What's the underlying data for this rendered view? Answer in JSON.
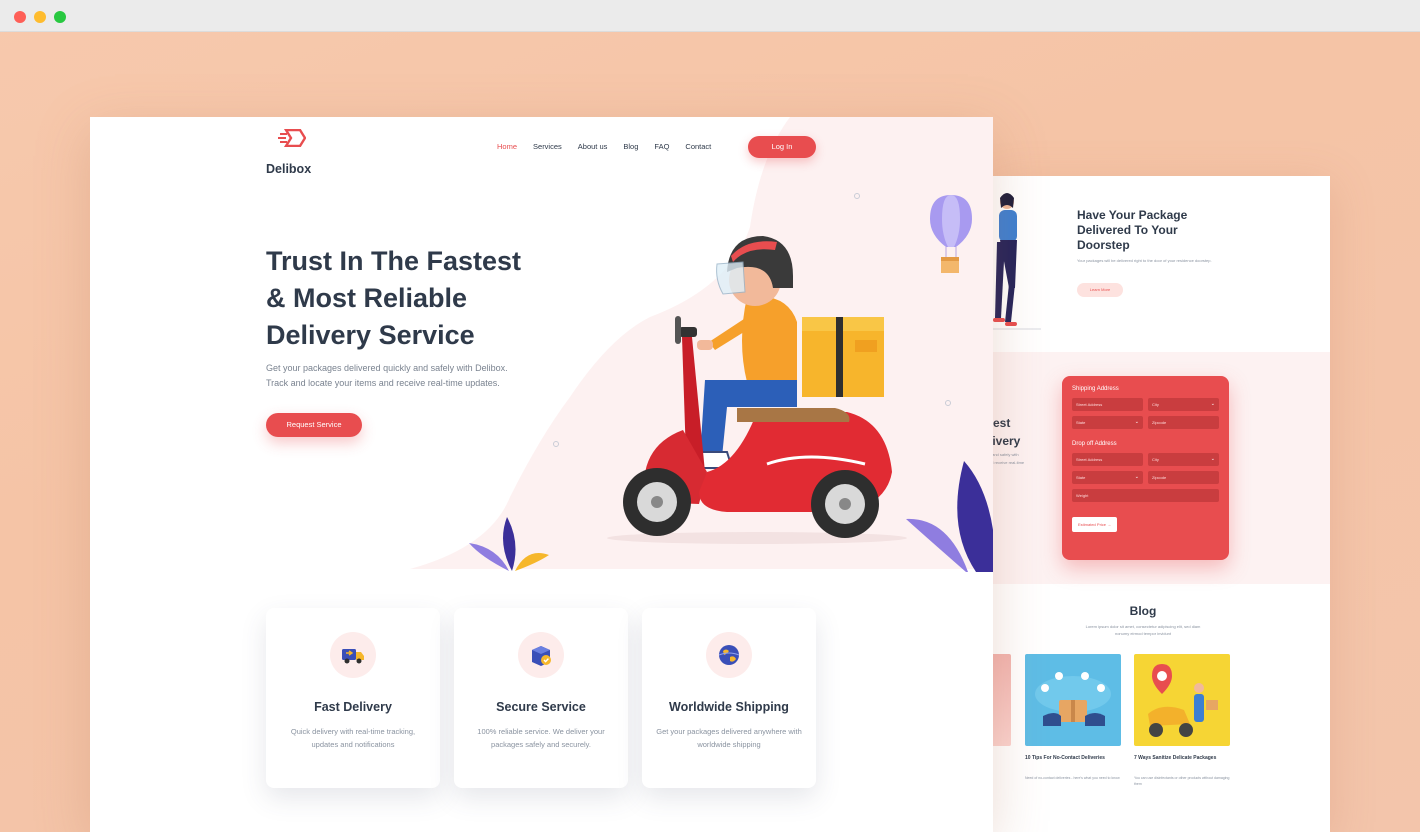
{
  "main": {
    "logo_text": "Delibox",
    "nav": [
      {
        "label": "Home",
        "active": true
      },
      {
        "label": "Services",
        "active": false
      },
      {
        "label": "About us",
        "active": false
      },
      {
        "label": "Blog",
        "active": false
      },
      {
        "label": "FAQ",
        "active": false
      },
      {
        "label": "Contact",
        "active": false
      }
    ],
    "login_label": "Log In",
    "hero": {
      "title_line1": "Trust In The Fastest",
      "title_line2": "& Most Reliable",
      "title_line3": "Delivery Service",
      "subtitle_line1": "Get your packages delivered quickly and safely with Delibox.",
      "subtitle_line2": "Track and locate your items and receive real-time updates.",
      "cta_label": "Request Service"
    },
    "features": [
      {
        "title": "Fast Delivery",
        "desc": "Quick delivery with real-time tracking, updates and notifications",
        "icon": "truck-icon"
      },
      {
        "title": "Secure Service",
        "desc": "100% reliable service. We deliver your packages safely and securely.",
        "icon": "shield-box-icon"
      },
      {
        "title": "Worldwide Shipping",
        "desc": "Get your packages delivered anywhere with worldwide shipping",
        "icon": "globe-icon"
      }
    ]
  },
  "secondary": {
    "hero_title": "Have Your Package Delivered To Your Doorstep",
    "hero_text": "Your packages will be delivered right to the door of your residence doorstep.",
    "learn_more": "Learn More",
    "cut_title_line1": "test",
    "cut_title_line2": "livery",
    "cut_text_line1": "y and safely with",
    "cut_text_line2": "nd receive real-time",
    "form": {
      "shipping_label": "Shipping Address",
      "dropoff_label": "Drop off Address",
      "street": "Street Address",
      "city": "City",
      "state": "State",
      "zip": "Zipcode",
      "weight": "Weight",
      "estimate_label": "Estimated Price"
    },
    "blog_title": "Blog",
    "blog_sub_line1": "Lorem ipsum dolor sit amet, consectetur adipiscing elit, sed diam",
    "blog_sub_line2": "nonumy eirmod tempor invidunt",
    "posts": [
      {
        "title": "10 Tips For No-Contact Deliveries",
        "desc": "Need of no-contact deliveries - here's what you need to know"
      },
      {
        "title": "7 Ways Sanitize Delicate Packages",
        "desc": "You can use disinfectants or other products without damaging them"
      }
    ]
  },
  "colors": {
    "accent": "#e84d4f",
    "text_dark": "#2f3a4a",
    "background": "#f5c4a6"
  }
}
